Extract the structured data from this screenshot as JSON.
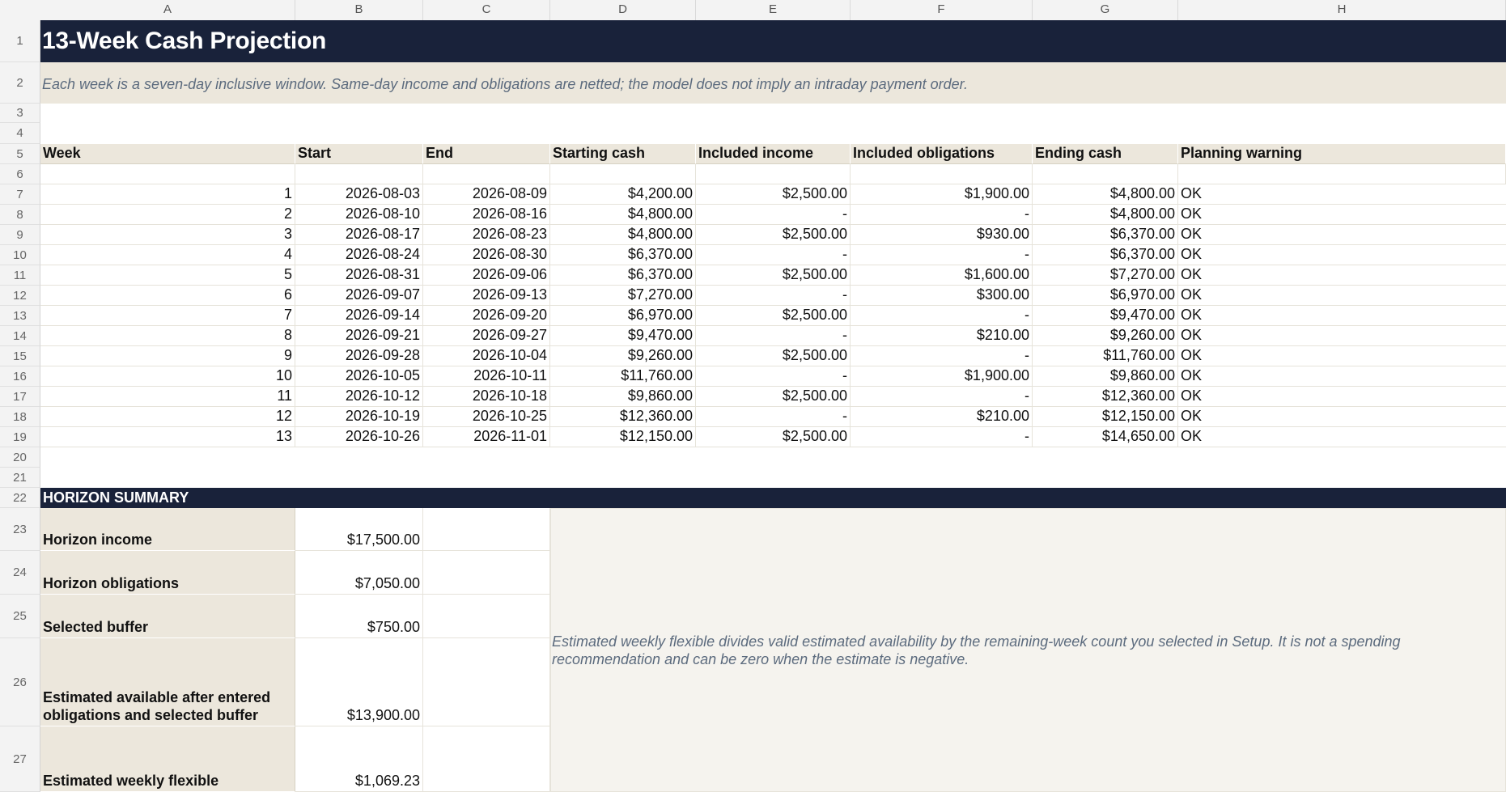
{
  "columns": [
    "A",
    "B",
    "C",
    "D",
    "E",
    "F",
    "G",
    "H"
  ],
  "rows": [
    "1",
    "2",
    "3",
    "4",
    "5",
    "6",
    "7",
    "8",
    "9",
    "10",
    "11",
    "12",
    "13",
    "14",
    "15",
    "16",
    "17",
    "18",
    "19",
    "20",
    "21",
    "22",
    "23",
    "24",
    "25",
    "26",
    "27"
  ],
  "title": "13-Week Cash Projection",
  "note": "Each week is a seven-day inclusive window. Same-day income and obligations are netted; the model does not imply an intraday payment order.",
  "headers": [
    "Week",
    "Start",
    "End",
    "Starting cash",
    "Included income",
    "Included obligations",
    "Ending cash",
    "Planning warning"
  ],
  "weeks": [
    [
      "1",
      "2026-08-03",
      "2026-08-09",
      "$4,200.00",
      "$2,500.00",
      "$1,900.00",
      "$4,800.00",
      "OK"
    ],
    [
      "2",
      "2026-08-10",
      "2026-08-16",
      "$4,800.00",
      "-",
      "-",
      "$4,800.00",
      "OK"
    ],
    [
      "3",
      "2026-08-17",
      "2026-08-23",
      "$4,800.00",
      "$2,500.00",
      "$930.00",
      "$6,370.00",
      "OK"
    ],
    [
      "4",
      "2026-08-24",
      "2026-08-30",
      "$6,370.00",
      "-",
      "-",
      "$6,370.00",
      "OK"
    ],
    [
      "5",
      "2026-08-31",
      "2026-09-06",
      "$6,370.00",
      "$2,500.00",
      "$1,600.00",
      "$7,270.00",
      "OK"
    ],
    [
      "6",
      "2026-09-07",
      "2026-09-13",
      "$7,270.00",
      "-",
      "$300.00",
      "$6,970.00",
      "OK"
    ],
    [
      "7",
      "2026-09-14",
      "2026-09-20",
      "$6,970.00",
      "$2,500.00",
      "-",
      "$9,470.00",
      "OK"
    ],
    [
      "8",
      "2026-09-21",
      "2026-09-27",
      "$9,470.00",
      "-",
      "$210.00",
      "$9,260.00",
      "OK"
    ],
    [
      "9",
      "2026-09-28",
      "2026-10-04",
      "$9,260.00",
      "$2,500.00",
      "-",
      "$11,760.00",
      "OK"
    ],
    [
      "10",
      "2026-10-05",
      "2026-10-11",
      "$11,760.00",
      "-",
      "$1,900.00",
      "$9,860.00",
      "OK"
    ],
    [
      "11",
      "2026-10-12",
      "2026-10-18",
      "$9,860.00",
      "$2,500.00",
      "-",
      "$12,360.00",
      "OK"
    ],
    [
      "12",
      "2026-10-19",
      "2026-10-25",
      "$12,360.00",
      "-",
      "$210.00",
      "$12,150.00",
      "OK"
    ],
    [
      "13",
      "2026-10-26",
      "2026-11-01",
      "$12,150.00",
      "$2,500.00",
      "-",
      "$14,650.00",
      "OK"
    ]
  ],
  "summary": {
    "heading": "HORIZON SUMMARY",
    "items": [
      {
        "label": "Horizon income",
        "value": "$17,500.00"
      },
      {
        "label": "Horizon obligations",
        "value": "$7,050.00"
      },
      {
        "label": "Selected buffer",
        "value": "$750.00"
      },
      {
        "label": "Estimated available after entered obligations and selected buffer",
        "value": "$13,900.00"
      },
      {
        "label": "Estimated weekly flexible",
        "value": "$1,069.23"
      }
    ],
    "note": "Estimated weekly flexible divides valid estimated availability by the remaining-week count you selected in Setup. It is not a spending recommendation and can be zero when the estimate is negative."
  },
  "colors": {
    "header_dark": "#19223a",
    "band_beige": "#ece7dc",
    "note_text": "#5c6b7e"
  }
}
